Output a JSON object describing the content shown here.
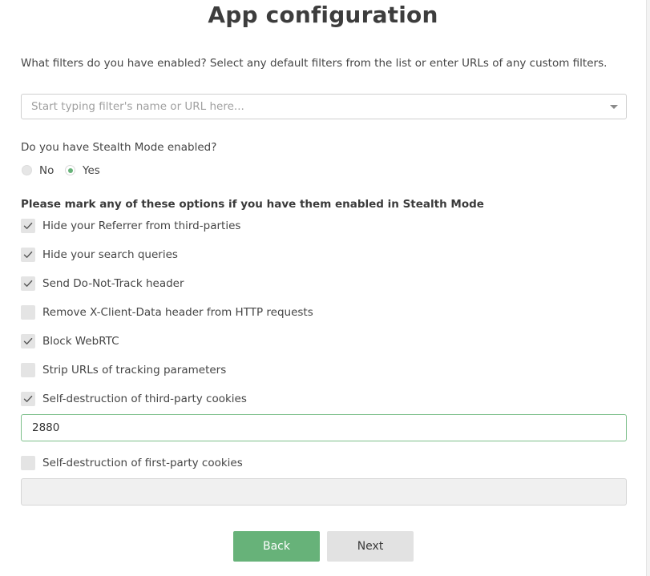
{
  "title": "App configuration",
  "filters": {
    "question": "What filters do you have enabled? Select any default filters from the list or enter URLs of any custom filters.",
    "placeholder": "Start typing filter's name or URL here...",
    "value": ""
  },
  "stealth": {
    "question": "Do you have Stealth Mode enabled?",
    "options": [
      {
        "label": "No",
        "selected": false
      },
      {
        "label": "Yes",
        "selected": true
      }
    ]
  },
  "options_section": {
    "heading": "Please mark any of these options if you have them enabled in Stealth Mode",
    "items": [
      {
        "label": "Hide your Referrer from third-parties",
        "checked": true
      },
      {
        "label": "Hide your search queries",
        "checked": true
      },
      {
        "label": "Send Do-Not-Track header",
        "checked": true
      },
      {
        "label": "Remove X-Client-Data header from HTTP requests",
        "checked": false
      },
      {
        "label": "Block WebRTC",
        "checked": true
      },
      {
        "label": "Strip URLs of tracking parameters",
        "checked": false
      },
      {
        "label": "Self-destruction of third-party cookies",
        "checked": true
      },
      {
        "label": "Self-destruction of first-party cookies",
        "checked": false
      }
    ],
    "third_party_cookie_value": "2880",
    "first_party_cookie_value": ""
  },
  "buttons": {
    "back": "Back",
    "next": "Next"
  },
  "colors": {
    "accent": "#67b279",
    "field_border_active": "#7cbf8a",
    "checkbox_bg": "#e4e4e4",
    "secondary_button": "#e2e2e2"
  },
  "icons": {
    "checkmark": "check-icon",
    "dropdown": "caret-down-icon"
  }
}
